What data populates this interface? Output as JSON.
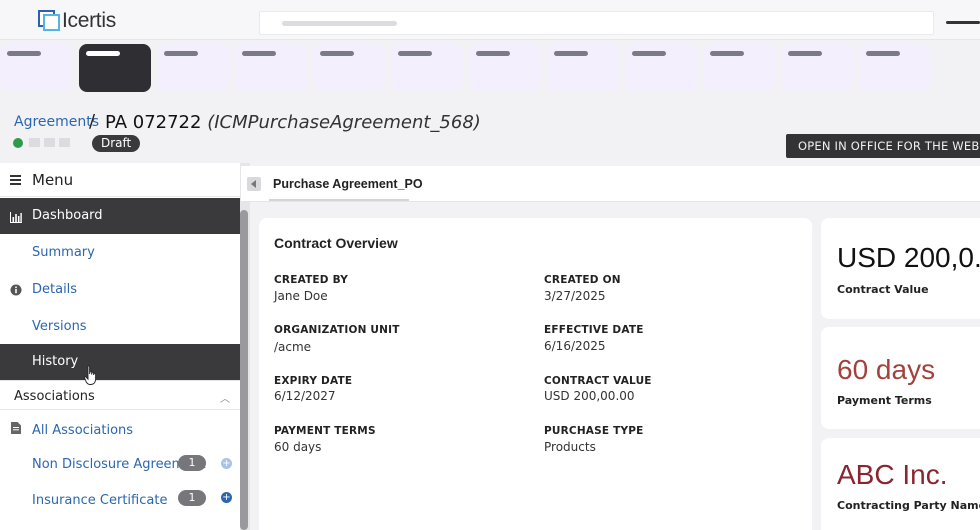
{
  "header": {
    "logo_text": "Icertis"
  },
  "breadcrumb": {
    "parent": "Agreements",
    "separator": "/",
    "title": "PA 072722",
    "subtitle": "(ICMPurchaseAgreement_568)",
    "status": "Draft"
  },
  "actions": {
    "open_office": "OPEN IN OFFICE FOR THE WEB"
  },
  "sidebar": {
    "menu_label": "Menu",
    "items": [
      {
        "label": "Dashboard",
        "icon": "chart-icon"
      },
      {
        "label": "Summary"
      },
      {
        "label": "Details",
        "icon": "info-icon"
      },
      {
        "label": "Versions"
      },
      {
        "label": "History"
      }
    ],
    "associations": {
      "label": "Associations",
      "items": [
        {
          "label": "All Associations",
          "icon": "document-icon"
        },
        {
          "label": "Non Disclosure Agreement",
          "count": "1"
        },
        {
          "label": "Insurance Certificate",
          "count": "1"
        }
      ]
    }
  },
  "document": {
    "tab_label": "Purchase Agreement_PO"
  },
  "overview": {
    "title": "Contract Overview",
    "fields": [
      {
        "label": "CREATED BY",
        "value": "Jane Doe"
      },
      {
        "label": "CREATED ON",
        "value": "3/27/2025"
      },
      {
        "label": "ORGANIZATION UNIT",
        "value": "/acme"
      },
      {
        "label": "EFFECTIVE DATE",
        "value": "6/16/2025"
      },
      {
        "label": "EXPIRY DATE",
        "value": "6/12/2027"
      },
      {
        "label": "CONTRACT VALUE",
        "value": "USD 200,00.00"
      },
      {
        "label": "PAYMENT TERMS",
        "value": "60 days"
      },
      {
        "label": "PURCHASE TYPE",
        "value": "Products"
      }
    ]
  },
  "kpis": [
    {
      "value": "USD 200,0.",
      "caption": "Contract Value",
      "color": "#111111"
    },
    {
      "value": "60 days",
      "caption": "Payment Terms",
      "color": "#a3423c"
    },
    {
      "value": "ABC Inc.",
      "caption": "Contracting Party Name",
      "color": "#8a2530"
    }
  ],
  "colors": {
    "link": "#2b66b1",
    "status_green": "#2e9b4a",
    "plus_light": "#a8c3ea",
    "plus_dark": "#2b66b1"
  }
}
